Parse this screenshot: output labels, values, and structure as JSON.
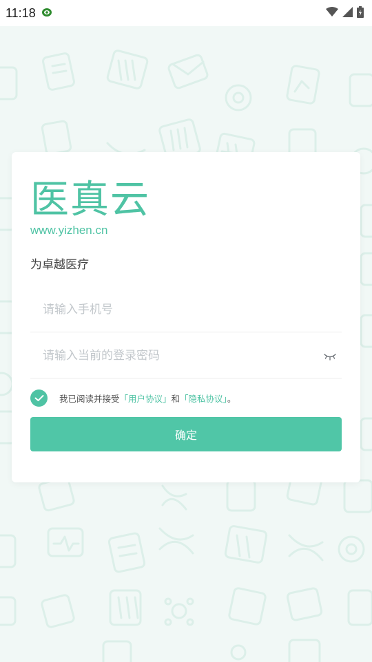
{
  "status_bar": {
    "time": "11:18",
    "icons": [
      "app-notification-icon",
      "wifi-icon",
      "signal-icon",
      "battery-icon"
    ]
  },
  "brand": {
    "logo_text": "医真云",
    "url": "www.yizhen.cn",
    "tagline": "为卓越医疗"
  },
  "form": {
    "phone_placeholder": "请输入手机号",
    "password_placeholder": "请输入当前的登录密码",
    "agreement": {
      "checked": true,
      "prefix": "我已阅读并接受",
      "user_agreement": "「用户协议」",
      "conjunction": "和",
      "privacy_agreement": "「隐私协议」",
      "suffix": "。"
    },
    "submit_label": "确定"
  },
  "colors": {
    "accent": "#4fc3a4",
    "button": "#50c6a7",
    "background": "#f1f8f6",
    "pattern": "#dcefe9"
  }
}
